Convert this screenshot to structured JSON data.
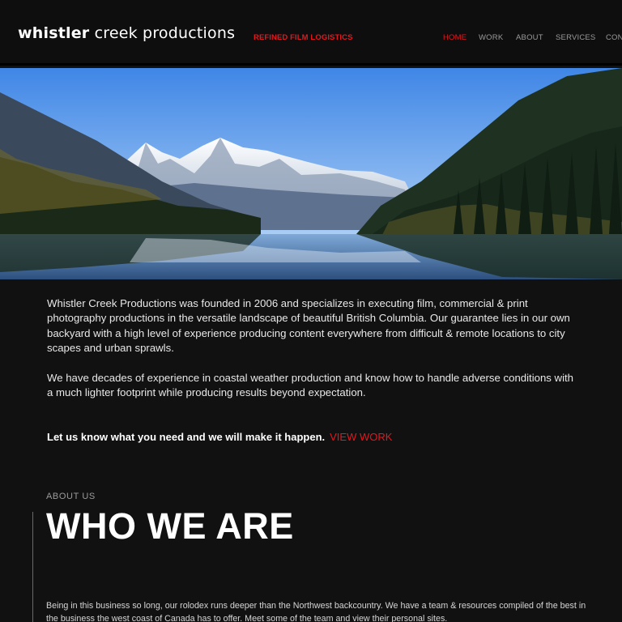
{
  "header": {
    "logo_bold": "whistler",
    "logo_rest": " creek productions",
    "tagline": "REFINED FILM LOGISTICS"
  },
  "nav": {
    "items": [
      {
        "label": "HOME",
        "active": true
      },
      {
        "label": "WORK",
        "active": false
      },
      {
        "label": "ABOUT",
        "active": false
      },
      {
        "label": "SERVICES",
        "active": false
      },
      {
        "label": "CONT",
        "active": false
      }
    ]
  },
  "hero": {
    "alt": "Mountain lake landscape"
  },
  "intro": {
    "paragraph1": "Whistler Creek Productions was founded in 2006 and specializes in executing film, commercial & print photography productions in the versatile landscape of beautiful British Columbia. Our guarantee lies in our own backyard with a high level of experience producing content everywhere from difficult & remote locations to city scapes and urban sprawls.",
    "paragraph2": "We have decades of experience in coastal weather production and know how to handle adverse conditions with a much lighter footprint while producing results beyond expectation."
  },
  "cta": {
    "text": "Let us know what you need and we will make it happen.",
    "link": "VIEW WORK"
  },
  "about": {
    "kicker": "ABOUT US",
    "title": "WHO WE ARE",
    "text": "Being in this business so long, our rolodex runs deeper than the Northwest backcountry. We have a team & resources compiled of the best in the business the west coast of Canada has to offer.  Meet some of the team and view their personal sites."
  },
  "colors": {
    "accent": "#e4171c",
    "background": "#111112",
    "nav_text": "#9a9a9a"
  }
}
